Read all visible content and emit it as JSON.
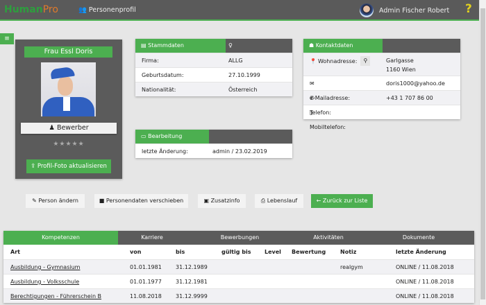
{
  "header": {
    "logo_main": "Human",
    "logo_suffix": "Pro",
    "page_title": "Personenprofil",
    "user_name": "Admin Fischer Robert",
    "help": "?"
  },
  "menu_icon": "≡",
  "profile": {
    "name": "Frau Essl Doris",
    "role": "Bewerber",
    "rating": 0,
    "rating_max": 5,
    "stars": "★★★★★",
    "upload_label": "Profil-Foto aktualisieren"
  },
  "stammdaten": {
    "title": "Stammdaten",
    "rows": [
      {
        "label": "Firma:",
        "value": "ALLG"
      },
      {
        "label": "Geburtsdatum:",
        "value": "27.10.1999"
      },
      {
        "label": "Nationalität:",
        "value": "Österreich"
      }
    ]
  },
  "kontakt": {
    "title": "Kontaktdaten",
    "address_label": "Wohnadresse:",
    "address_line1": "Garlgasse",
    "address_line2": "1160 Wien",
    "email_label": "e-Mailadresse:",
    "email": "doris1000@yahoo.de",
    "phone_label": "Telefon:",
    "phone": "+43 1 707 86 00",
    "mobile_label": "Mobiltelefon:",
    "mobile": ""
  },
  "bearbeitung": {
    "title": "Bearbeitung",
    "label": "letzte Änderung:",
    "value": "admin / 23.02.2019"
  },
  "actions": {
    "edit": "Person ändern",
    "move": "Personendaten verschieben",
    "extra": "Zusatzinfo",
    "cv": "Lebenslauf",
    "back": "Zurück zur Liste"
  },
  "tabs": [
    "Kompetenzen",
    "Karriere",
    "Bewerbungen",
    "Aktivitäten",
    "Dokumente"
  ],
  "table": {
    "columns": [
      "Art",
      "von",
      "bis",
      "gültig bis",
      "Level",
      "Bewertung",
      "Notiz",
      "letzte Änderung"
    ],
    "rows": [
      {
        "art": "Ausbildung - Gymnasium",
        "von": "01.01.1981",
        "bis": "31.12.1989",
        "notiz": "realgym",
        "changed": "ONLINE / 11.08.2018"
      },
      {
        "art": "Ausbildung - Volksschule",
        "von": "01.01.1977",
        "bis": "31.12.1981",
        "notiz": "",
        "changed": "ONLINE / 11.08.2018"
      },
      {
        "art": "Berechtigungen - Führerschein B",
        "von": "11.08.2018",
        "bis": "31.12.9999",
        "notiz": "",
        "changed": "ONLINE / 11.08.2018"
      }
    ]
  }
}
